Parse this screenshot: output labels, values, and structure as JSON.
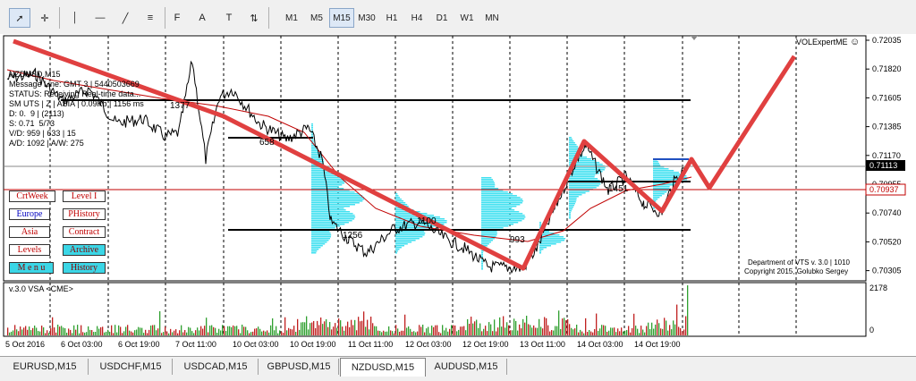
{
  "toolbar": {
    "buttons": [
      {
        "name": "cursor-arrow-icon",
        "glyph": "➚"
      },
      {
        "name": "crosshair-icon",
        "glyph": "✛"
      },
      {
        "name": "vertical-line-icon",
        "glyph": "│"
      },
      {
        "name": "horizontal-line-icon",
        "glyph": "—"
      },
      {
        "name": "trendline-icon",
        "glyph": "╱"
      },
      {
        "name": "equidistant-channel-icon",
        "glyph": "≡"
      },
      {
        "name": "fibonacci-icon",
        "glyph": "F"
      },
      {
        "name": "text-icon",
        "glyph": "A"
      },
      {
        "name": "text-label-icon",
        "glyph": "T"
      },
      {
        "name": "arrows-icon",
        "glyph": "⇅"
      }
    ],
    "timeframes": [
      "M1",
      "M5",
      "M15",
      "M30",
      "H1",
      "H4",
      "D1",
      "W1",
      "MN"
    ],
    "active_timeframe": "M15"
  },
  "info_panel": {
    "symbol": "NZDUSD,M15",
    "lines": [
      "Message Line: GMT 3 | 5440503669",
      "STATUS: Receiving Real-time data...",
      "SM UTS | Z | ASIA | 0.09Kb | 1156 ms",
      "D: 0.  9 | (2113)",
      "S: 0.71  5/73",
      "V/D: 959 | 633 | 15",
      "A/D: 1092 | A/W: 275"
    ]
  },
  "ea_label": "VOLExpertME",
  "smiley": "☺",
  "price_axis": [
    "0.72035",
    "0.71820",
    "0.71605",
    "0.71385",
    "0.71170",
    "0.70955",
    "0.70740",
    "0.70520",
    "0.70305"
  ],
  "current_price": "0.71113",
  "red_line_price": "0.70937",
  "vol_axis": {
    "top": "2178",
    "bottom": "0"
  },
  "indicator_label": "v.3.0 VSA <CME>",
  "time_axis": [
    "5 Oct 2016",
    "6 Oct 03:00",
    "6 Oct 19:00",
    "7 Oct 11:00",
    "10 Oct 03:00",
    "10 Oct 19:00",
    "11 Oct 11:00",
    "12 Oct 03:00",
    "12 Oct 19:00",
    "13 Oct 11:00",
    "14 Oct 03:00",
    "14 Oct 19:00"
  ],
  "level_labels": [
    "1377",
    "658",
    "1256",
    "1100",
    "993",
    "1451"
  ],
  "copyright": [
    "Department of VTS  v. 3.0 | 1010",
    "Copyright 2015, Golubko Sergey"
  ],
  "left_buttons": [
    {
      "label": "CrtWeek",
      "style": "white",
      "color": "#c00000"
    },
    {
      "label": "Level I",
      "style": "white",
      "color": "#c00000"
    },
    {
      "label": "Europe",
      "style": "white",
      "color": "#0000c0"
    },
    {
      "label": "PHistory",
      "style": "white",
      "color": "#c00000"
    },
    {
      "label": "Asia",
      "style": "white",
      "color": "#c00000"
    },
    {
      "label": "Contract",
      "style": "white",
      "color": "#c00000"
    },
    {
      "label": "Levels",
      "style": "white",
      "color": "#c00000"
    },
    {
      "label": "Archive",
      "style": "cyan",
      "color": "#8a0000"
    },
    {
      "label": "M e n u",
      "style": "cyan",
      "color": "#8a0000"
    },
    {
      "label": "History",
      "style": "cyan",
      "color": "#8a0000"
    }
  ],
  "tabs": [
    "EURUSD,M15",
    "USDCHF,M15",
    "USDCAD,M15",
    "GBPUSD,M15",
    "NZDUSD,M15",
    "AUDUSD,M15"
  ],
  "active_tab": "NZDUSD,M15",
  "colors": {
    "trend_red": "#e04040",
    "ma_red": "#c00000",
    "profile_cyan": "#40e0f0",
    "level_black": "#000000",
    "line_blue": "#2050c0"
  }
}
